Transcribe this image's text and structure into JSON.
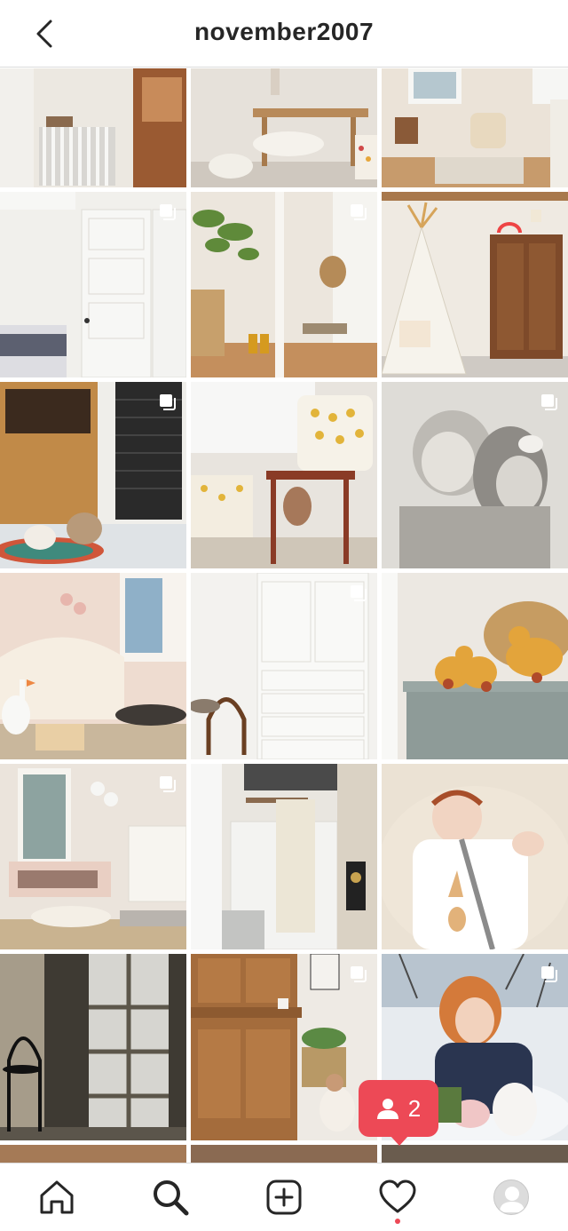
{
  "header": {
    "title": "november2007"
  },
  "notification": {
    "count": "2"
  },
  "colors": {
    "accent": "#ed4956",
    "text": "#262626",
    "divider": "#dbdbdb"
  },
  "tiles": [
    {
      "name": "post-radiator-door",
      "multi": false
    },
    {
      "name": "post-bench-sheepskin",
      "multi": false
    },
    {
      "name": "post-nursery-room",
      "multi": false
    },
    {
      "name": "post-white-door-bed",
      "multi": true
    },
    {
      "name": "post-entry-boots-plant",
      "multi": true
    },
    {
      "name": "post-teepee-armoire",
      "multi": false
    },
    {
      "name": "post-dogs-wooden-door",
      "multi": true
    },
    {
      "name": "post-chair-dog-pillow",
      "multi": false
    },
    {
      "name": "post-bw-girls-hug",
      "multi": true
    },
    {
      "name": "post-pink-bedroom-goose",
      "multi": false
    },
    {
      "name": "post-white-cabinet-chair",
      "multi": true
    },
    {
      "name": "post-wooden-ducks",
      "multi": false
    },
    {
      "name": "post-bedroom-dresser",
      "multi": true
    },
    {
      "name": "post-bathroom-towel",
      "multi": false
    },
    {
      "name": "post-sleeping-baby",
      "multi": false
    },
    {
      "name": "post-french-doors-chair",
      "multi": false
    },
    {
      "name": "post-wood-hutch-toddler",
      "multi": true
    },
    {
      "name": "post-toddler-in-snow",
      "multi": true
    }
  ],
  "nav": {
    "items": [
      "home-icon",
      "search-icon",
      "create-icon",
      "activity-icon",
      "profile-avatar"
    ]
  }
}
